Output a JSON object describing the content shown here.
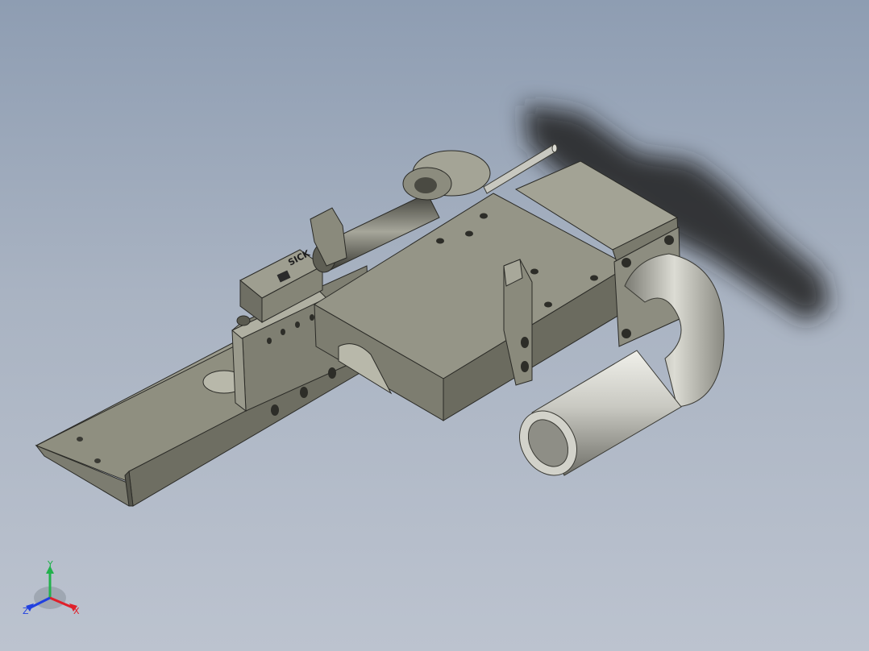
{
  "viewport": {
    "background_top": "#8e9db2",
    "background_bottom": "#bcc3cf",
    "model_color": "#8f8f80",
    "pipe_color": "#c9c9c2"
  },
  "label": {
    "brand_text": "SICK"
  },
  "triad": {
    "x_label": "X",
    "y_label": "Y",
    "z_label": "Z",
    "x_color": "#e0202a",
    "y_color": "#22b14c",
    "z_color": "#2040e0"
  }
}
